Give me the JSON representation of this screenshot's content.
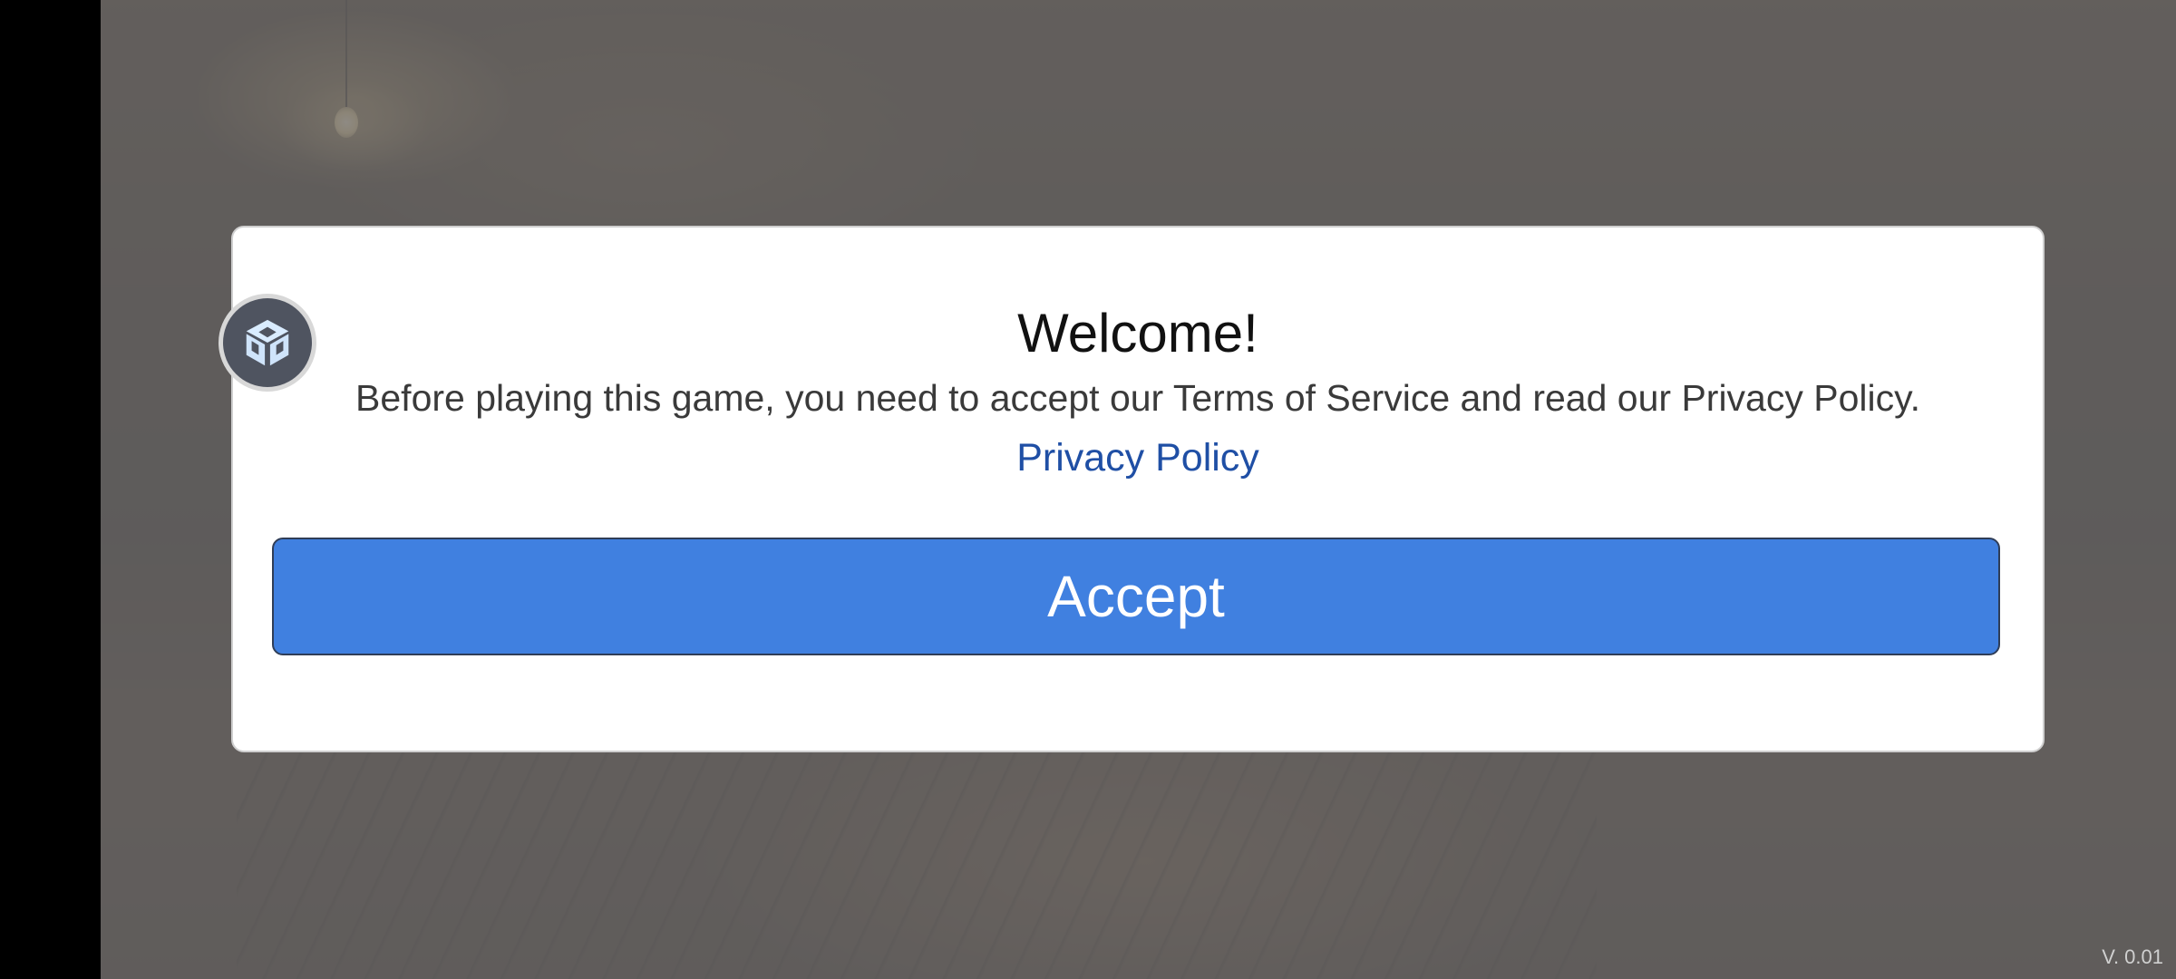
{
  "dialog": {
    "title": "Welcome!",
    "message": "Before playing this game, you need to accept our Terms of Service and read our Privacy Policy.",
    "privacy_link": "Privacy Policy",
    "accept_label": "Accept"
  },
  "avatar": {
    "icon": "cube-icon"
  },
  "footer": {
    "version": "V. 0.01"
  },
  "colors": {
    "accent_button": "#4080e0",
    "link": "#1f4fa5",
    "overlay": "#6e6c6c"
  }
}
